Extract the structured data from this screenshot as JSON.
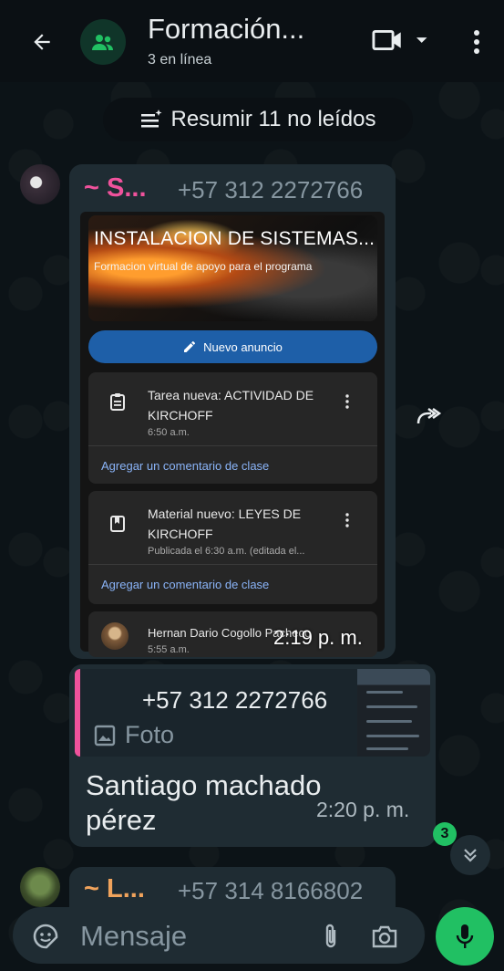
{
  "header": {
    "title": "Formación...",
    "subtitle": "3 en línea"
  },
  "summary": {
    "label": "Resumir 11 no leídos"
  },
  "messages": [
    {
      "sender_name": "~ S...",
      "sender_phone": "+57 312 2272766",
      "time": "2:19 p. m.",
      "screenshot": {
        "banner_title": "INSTALACION DE SISTEMAS...",
        "banner_subtitle": "Formacion virtual de apoyo para el programa",
        "announce_button": "Nuevo anuncio",
        "posts": [
          {
            "title": "Tarea nueva: ACTIVIDAD DE KIRCHOFF",
            "meta": "6:50 a.m.",
            "comment": "Agregar un comentario de clase",
            "icon": "assignment-icon"
          },
          {
            "title": "Material nuevo: LEYES DE KIRCHOFF",
            "meta": "Publicada el 6:30 a.m. (editada el...",
            "comment": "Agregar un comentario de clase",
            "icon": "material-icon"
          }
        ],
        "last_post": {
          "author": "Hernan Dario Cogollo Pacheco",
          "time": "5:55 a.m."
        }
      }
    },
    {
      "quote_phone": "+57 312 2272766",
      "quote_type": "Foto",
      "text": "Santiago machado pérez",
      "time": "2:20 p. m."
    },
    {
      "sender_name": "~ L...",
      "sender_phone": "+57 314 8166802"
    }
  ],
  "unread_count": "3",
  "input": {
    "placeholder": "Mensaje"
  },
  "colors": {
    "accent_green": "#21c063",
    "bubble": "#1f2c33",
    "sender1": "#f0529c",
    "sender3": "#f0a35c"
  }
}
